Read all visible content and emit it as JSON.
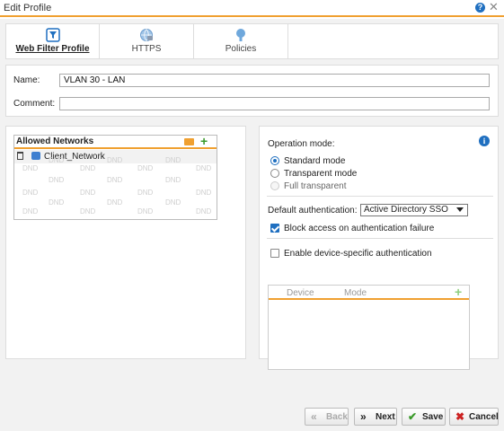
{
  "window": {
    "title": "Edit Profile"
  },
  "tabs": [
    {
      "label": "Web Filter Profile",
      "icon": "filter-icon",
      "active": true
    },
    {
      "label": "HTTPS",
      "icon": "globe-icon",
      "active": false
    },
    {
      "label": "Policies",
      "icon": "policy-pin-icon",
      "active": false
    }
  ],
  "form": {
    "name_label": "Name:",
    "name_value": "VLAN 30 - LAN",
    "comment_label": "Comment:",
    "comment_value": ""
  },
  "allowed_networks": {
    "header": "Allowed Networks",
    "items": [
      {
        "label": "Client_Network"
      }
    ],
    "placeholder": "DND"
  },
  "operation": {
    "label": "Operation mode:",
    "options": [
      {
        "label": "Standard mode",
        "checked": true,
        "disabled": false
      },
      {
        "label": "Transparent mode",
        "checked": false,
        "disabled": false
      },
      {
        "label": "Full transparent",
        "checked": false,
        "disabled": true
      }
    ]
  },
  "auth": {
    "default_label": "Default authentication:",
    "default_value": "Active Directory SSO",
    "block_label": "Block access on authentication failure",
    "block_checked": true,
    "device_label": "Enable device-specific authentication",
    "device_checked": false
  },
  "device_table": {
    "columns": [
      "Device",
      "Mode"
    ]
  },
  "buttons": {
    "back": "Back",
    "next": "Next",
    "save": "Save",
    "cancel": "Cancel"
  },
  "colors": {
    "accent": "#f0a030",
    "primary": "#1f6fc0",
    "green": "#3a9a2a",
    "red": "#cc2222"
  }
}
